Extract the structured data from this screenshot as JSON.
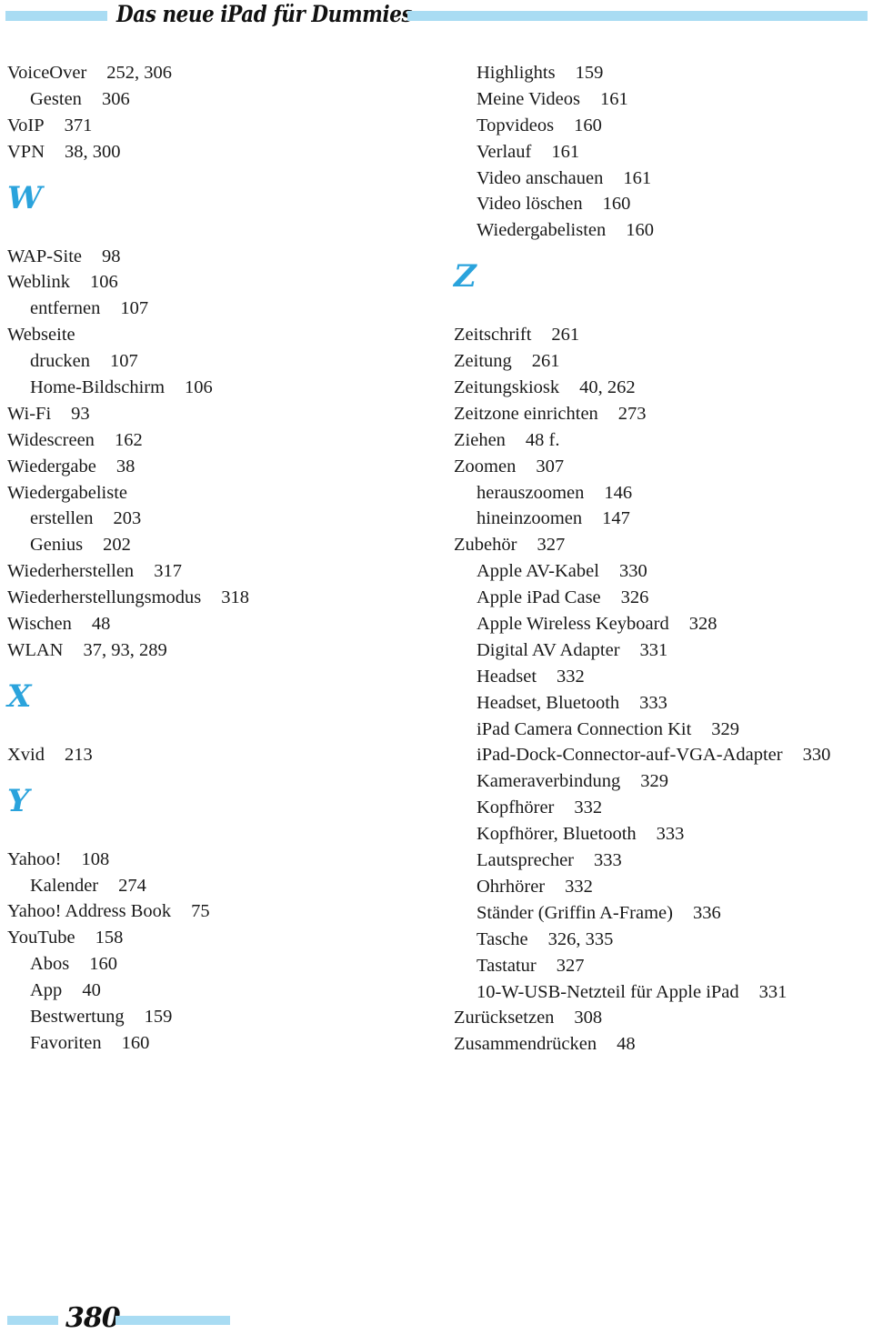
{
  "header": {
    "title": "Das neue iPad für Dummies"
  },
  "left_column": [
    {
      "type": "entry",
      "level": 0,
      "term": "VoiceOver",
      "pages": "252, 306"
    },
    {
      "type": "entry",
      "level": 1,
      "term": "Gesten",
      "pages": "306"
    },
    {
      "type": "entry",
      "level": 0,
      "term": "VoIP",
      "pages": "371"
    },
    {
      "type": "entry",
      "level": 0,
      "term": "VPN",
      "pages": "38, 300"
    },
    {
      "type": "letter",
      "letter": "W"
    },
    {
      "type": "entry",
      "level": 0,
      "term": "WAP-Site",
      "pages": "98"
    },
    {
      "type": "entry",
      "level": 0,
      "term": "Weblink",
      "pages": "106"
    },
    {
      "type": "entry",
      "level": 1,
      "term": "entfernen",
      "pages": "107"
    },
    {
      "type": "entry",
      "level": 0,
      "term": "Webseite",
      "pages": ""
    },
    {
      "type": "entry",
      "level": 1,
      "term": "drucken",
      "pages": "107"
    },
    {
      "type": "entry",
      "level": 1,
      "term": "Home-Bildschirm",
      "pages": "106"
    },
    {
      "type": "entry",
      "level": 0,
      "term": "Wi-Fi",
      "pages": "93"
    },
    {
      "type": "entry",
      "level": 0,
      "term": "Widescreen",
      "pages": "162"
    },
    {
      "type": "entry",
      "level": 0,
      "term": "Wiedergabe",
      "pages": "38"
    },
    {
      "type": "entry",
      "level": 0,
      "term": "Wiedergabeliste",
      "pages": ""
    },
    {
      "type": "entry",
      "level": 1,
      "term": "erstellen",
      "pages": "203"
    },
    {
      "type": "entry",
      "level": 1,
      "term": "Genius",
      "pages": "202"
    },
    {
      "type": "entry",
      "level": 0,
      "term": "Wiederherstellen",
      "pages": "317"
    },
    {
      "type": "entry",
      "level": 0,
      "term": "Wiederherstellungsmodus",
      "pages": "318"
    },
    {
      "type": "entry",
      "level": 0,
      "term": "Wischen",
      "pages": "48"
    },
    {
      "type": "entry",
      "level": 0,
      "term": "WLAN",
      "pages": "37, 93, 289"
    },
    {
      "type": "letter",
      "letter": "X"
    },
    {
      "type": "entry",
      "level": 0,
      "term": "Xvid",
      "pages": "213"
    },
    {
      "type": "letter",
      "letter": "Y"
    },
    {
      "type": "entry",
      "level": 0,
      "term": "Yahoo!",
      "pages": "108"
    },
    {
      "type": "entry",
      "level": 1,
      "term": "Kalender",
      "pages": "274"
    },
    {
      "type": "entry",
      "level": 0,
      "term": "Yahoo! Address Book",
      "pages": "75"
    },
    {
      "type": "entry",
      "level": 0,
      "term": "YouTube",
      "pages": "158"
    },
    {
      "type": "entry",
      "level": 1,
      "term": "Abos",
      "pages": "160"
    },
    {
      "type": "entry",
      "level": 1,
      "term": "App",
      "pages": "40"
    },
    {
      "type": "entry",
      "level": 1,
      "term": "Bestwertung",
      "pages": "159"
    },
    {
      "type": "entry",
      "level": 1,
      "term": "Favoriten",
      "pages": "160"
    }
  ],
  "right_column": [
    {
      "type": "entry",
      "level": 1,
      "term": "Highlights",
      "pages": "159"
    },
    {
      "type": "entry",
      "level": 1,
      "term": "Meine Videos",
      "pages": "161"
    },
    {
      "type": "entry",
      "level": 1,
      "term": "Topvideos",
      "pages": "160"
    },
    {
      "type": "entry",
      "level": 1,
      "term": "Verlauf",
      "pages": "161"
    },
    {
      "type": "entry",
      "level": 1,
      "term": "Video anschauen",
      "pages": "161"
    },
    {
      "type": "entry",
      "level": 1,
      "term": "Video löschen",
      "pages": "160"
    },
    {
      "type": "entry",
      "level": 1,
      "term": "Wiedergabelisten",
      "pages": "160"
    },
    {
      "type": "letter",
      "letter": "Z"
    },
    {
      "type": "entry",
      "level": 0,
      "term": "Zeitschrift",
      "pages": "261"
    },
    {
      "type": "entry",
      "level": 0,
      "term": "Zeitung",
      "pages": "261"
    },
    {
      "type": "entry",
      "level": 0,
      "term": "Zeitungskiosk",
      "pages": "40, 262"
    },
    {
      "type": "entry",
      "level": 0,
      "term": "Zeitzone einrichten",
      "pages": "273"
    },
    {
      "type": "entry",
      "level": 0,
      "term": "Ziehen",
      "pages": "48 f."
    },
    {
      "type": "entry",
      "level": 0,
      "term": "Zoomen",
      "pages": "307"
    },
    {
      "type": "entry",
      "level": 1,
      "term": "herauszoomen",
      "pages": "146"
    },
    {
      "type": "entry",
      "level": 1,
      "term": "hineinzoomen",
      "pages": "147"
    },
    {
      "type": "entry",
      "level": 0,
      "term": "Zubehör",
      "pages": "327"
    },
    {
      "type": "entry",
      "level": 1,
      "term": "Apple AV-Kabel",
      "pages": "330"
    },
    {
      "type": "entry",
      "level": 1,
      "term": "Apple iPad Case",
      "pages": "326"
    },
    {
      "type": "entry",
      "level": 1,
      "term": "Apple Wireless Keyboard",
      "pages": "328"
    },
    {
      "type": "entry",
      "level": 1,
      "term": "Digital AV Adapter",
      "pages": "331"
    },
    {
      "type": "entry",
      "level": 1,
      "term": "Headset",
      "pages": "332"
    },
    {
      "type": "entry",
      "level": 1,
      "term": "Headset, Bluetooth",
      "pages": "333"
    },
    {
      "type": "entry",
      "level": 1,
      "term": "iPad Camera Connection Kit",
      "pages": "329"
    },
    {
      "type": "entry",
      "level": 1,
      "term": "iPad-Dock-Connector-auf-VGA-Adapter",
      "pages": "330"
    },
    {
      "type": "entry",
      "level": 1,
      "term": "Kameraverbindung",
      "pages": "329"
    },
    {
      "type": "entry",
      "level": 1,
      "term": "Kopfhörer",
      "pages": "332"
    },
    {
      "type": "entry",
      "level": 1,
      "term": "Kopfhörer, Bluetooth",
      "pages": "333"
    },
    {
      "type": "entry",
      "level": 1,
      "term": "Lautsprecher",
      "pages": "333"
    },
    {
      "type": "entry",
      "level": 1,
      "term": "Ohrhörer",
      "pages": "332"
    },
    {
      "type": "entry",
      "level": 1,
      "term": "Ständer (Griffin A-Frame)",
      "pages": "336"
    },
    {
      "type": "entry",
      "level": 1,
      "term": "Tasche",
      "pages": "326, 335"
    },
    {
      "type": "entry",
      "level": 1,
      "term": "Tastatur",
      "pages": "327"
    },
    {
      "type": "entry",
      "level": 1,
      "term": "10-W-USB-Netzteil für Apple iPad",
      "pages": "331"
    },
    {
      "type": "entry",
      "level": 0,
      "term": "Zurücksetzen",
      "pages": "308"
    },
    {
      "type": "entry",
      "level": 0,
      "term": "Zusammendrücken",
      "pages": "48"
    }
  ],
  "footer": {
    "page_number": "380"
  },
  "colors": {
    "accent_bar": "#a9dcf3",
    "letter_heading": "#2aa3dc",
    "text": "#1a1a1a"
  }
}
